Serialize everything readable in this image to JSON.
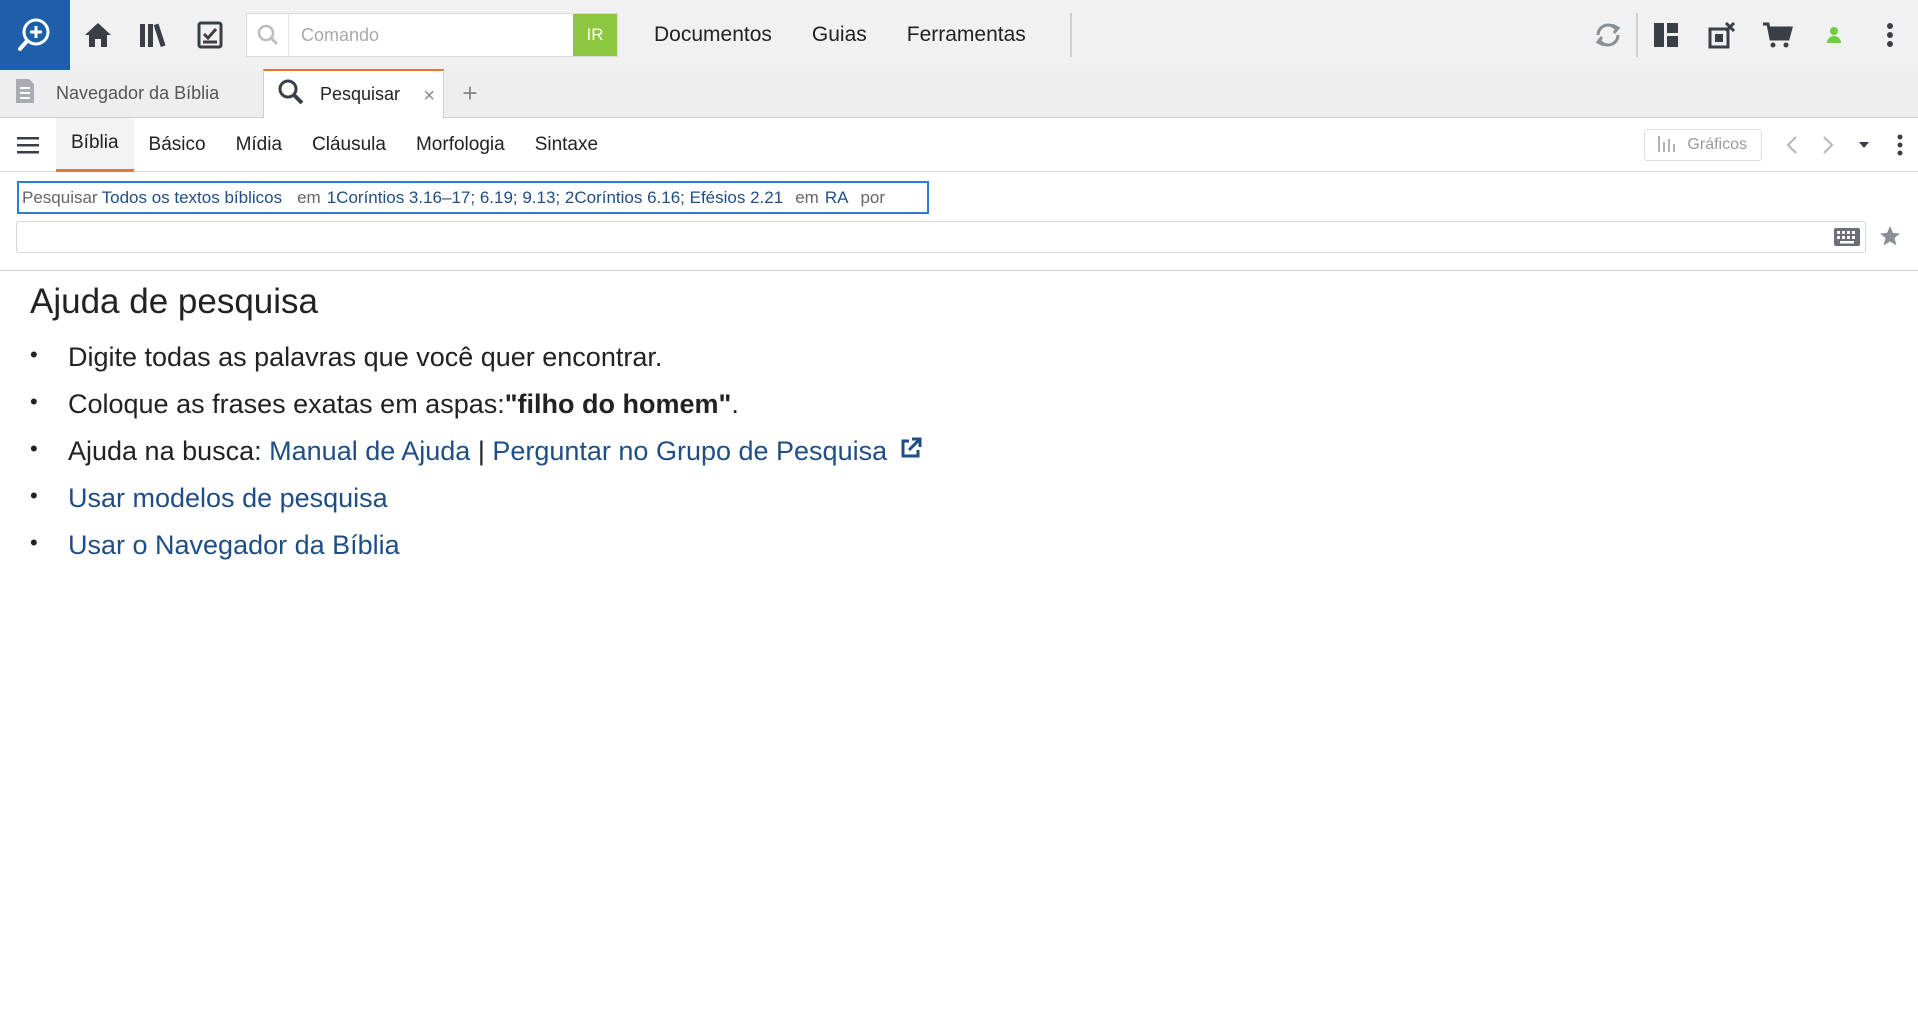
{
  "toolbar": {
    "command_placeholder": "Comando",
    "go_label": "IR",
    "nav": [
      "Documentos",
      "Guias",
      "Ferramentas"
    ]
  },
  "tabs": [
    {
      "label": "Navegador da Bíblia"
    },
    {
      "label": "Pesquisar",
      "close": "×"
    }
  ],
  "tab_add": "+",
  "panel_tabs": [
    "Bíblia",
    "Básico",
    "Mídia",
    "Cláusula",
    "Morfologia",
    "Sintaxe"
  ],
  "panel_right": {
    "graficos_label": "Gráficos"
  },
  "query": {
    "prefix": "Pesquisar",
    "scope": "Todos os textos bíblicos",
    "em1": "em",
    "range": "1Coríntios 3.16–17; 6.19; 9.13; 2Coríntios 6.16; Efésios 2.21",
    "em2": "em",
    "version": "RA",
    "por": "por",
    "input_value": ""
  },
  "help": {
    "title": "Ajuda de pesquisa",
    "line1": "Digite todas as palavras que você quer encontrar.",
    "line2_pre": "Coloque as frases exatas em aspas: ",
    "line2_bold": "\"filho do homem\"",
    "line2_post": ".",
    "line3_pre": "Ajuda na busca: ",
    "line3_link1": "Manual de Ajuda",
    "line3_sep": " | ",
    "line3_link2": "Perguntar no Grupo de Pesquisa",
    "line4_link": "Usar modelos de pesquisa",
    "line5_link": "Usar o Navegador da Bíblia"
  },
  "colors": {
    "logo_bg": "#1f5ea8",
    "go_button": "#8dc63f",
    "active_tab_accent": "#e8743b",
    "link": "#1f4e86",
    "query_border": "#2a7fd3",
    "status_dot": "#6ccf3f"
  },
  "icons": [
    "logo-icon",
    "home-icon",
    "library-icon",
    "checklist-icon",
    "search-icon",
    "sync-icon",
    "layout-icon",
    "close-panels-icon",
    "cart-icon",
    "user-status-icon",
    "more-vert-icon",
    "reading-plan-icon",
    "hamburger-icon",
    "chart-icon",
    "chevron-left-icon",
    "chevron-right-icon",
    "caret-down-icon",
    "keyboard-icon",
    "star-icon",
    "external-link-icon"
  ]
}
